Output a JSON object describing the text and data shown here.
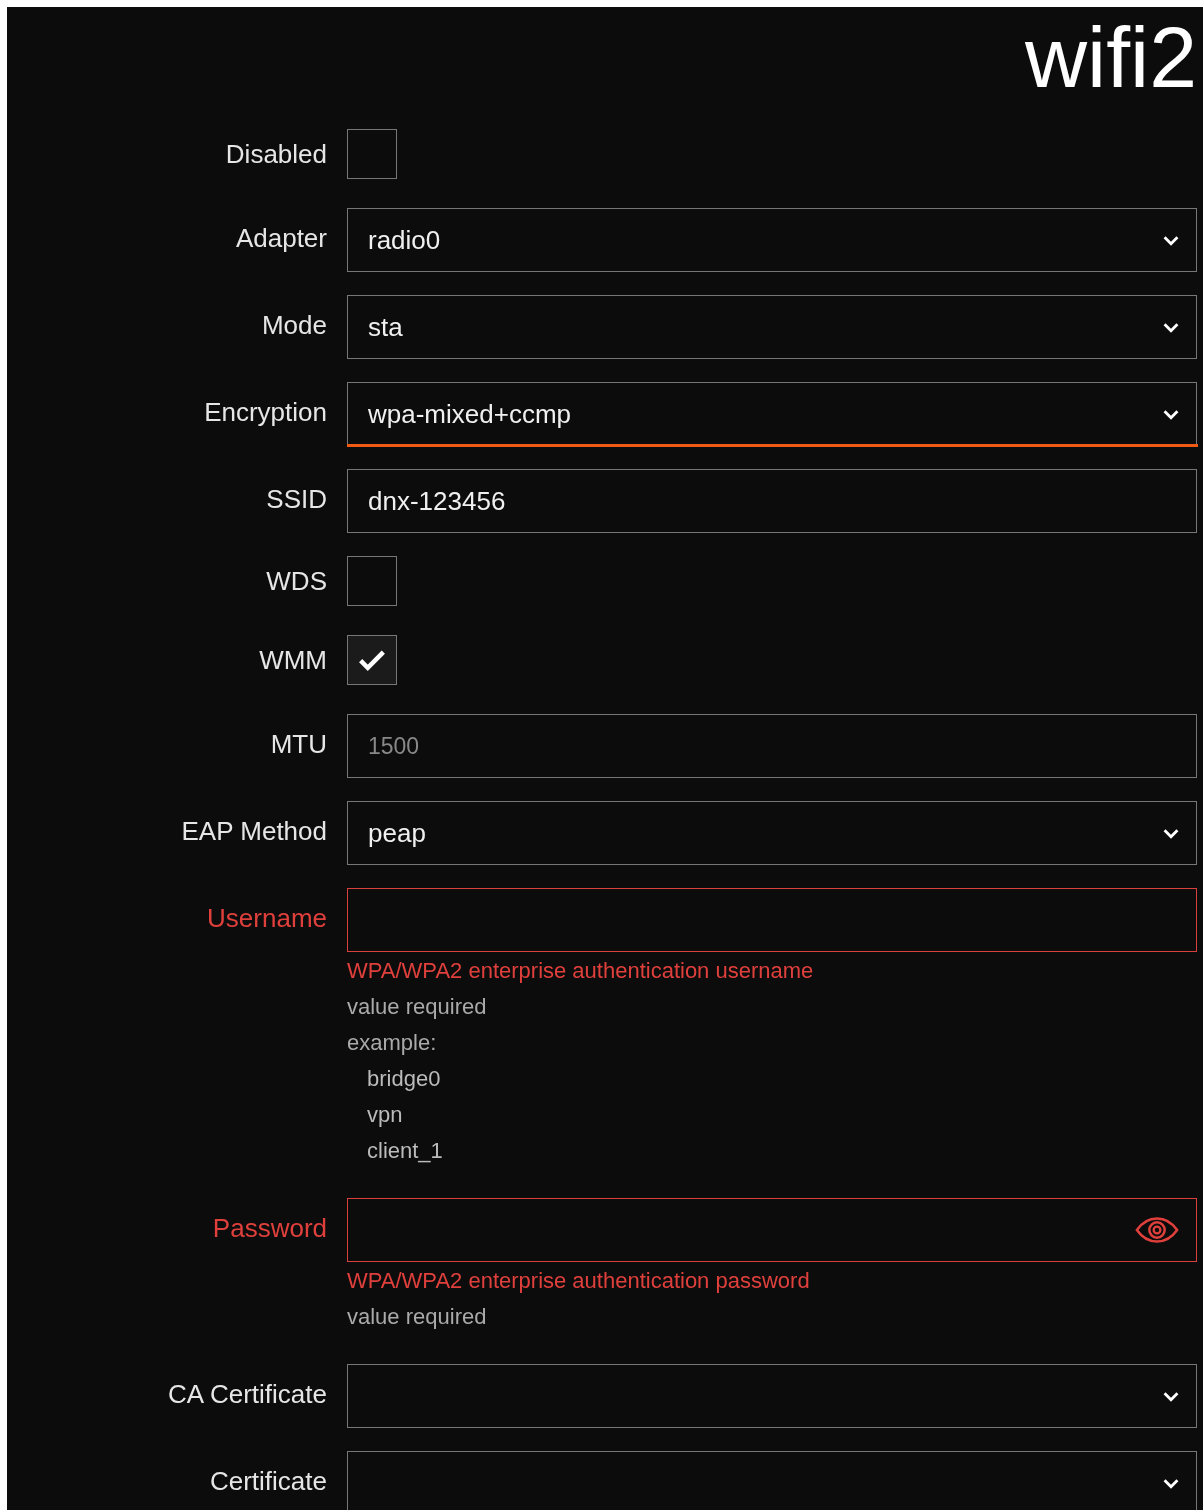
{
  "title": "wifi2",
  "fields": [
    {
      "kind": "checkbox",
      "label": "Disabled",
      "checked": false,
      "invalid": false
    },
    {
      "kind": "select",
      "label": "Adapter",
      "value": "radio0",
      "focused": false,
      "invalid": false
    },
    {
      "kind": "select",
      "label": "Mode",
      "value": "sta",
      "focused": false,
      "invalid": false
    },
    {
      "kind": "select",
      "label": "Encryption",
      "value": "wpa-mixed+ccmp",
      "focused": true,
      "invalid": false
    },
    {
      "kind": "text",
      "label": "SSID",
      "value": "dnx-123456",
      "focused": false,
      "invalid": false
    },
    {
      "kind": "checkbox",
      "label": "WDS",
      "checked": false,
      "invalid": false
    },
    {
      "kind": "checkbox",
      "label": "WMM",
      "checked": true,
      "invalid": false
    },
    {
      "kind": "text",
      "label": "MTU",
      "placeholder": "1500",
      "focused": false,
      "invalid": false
    },
    {
      "kind": "select",
      "label": "EAP Method",
      "value": "peap",
      "focused": false,
      "invalid": false
    },
    {
      "kind": "text",
      "label": "Username",
      "focused": false,
      "invalid": true,
      "hint": "WPA/WPA2 enterprise authentication username",
      "error": "value required",
      "example_label": "example:",
      "examples": [
        "bridge0",
        "vpn",
        "client_1"
      ]
    },
    {
      "kind": "password",
      "label": "Password",
      "focused": false,
      "invalid": true,
      "hint": "WPA/WPA2 enterprise authentication password",
      "error": "value required"
    },
    {
      "kind": "select",
      "label": "CA Certificate",
      "focused": false,
      "invalid": false
    },
    {
      "kind": "select",
      "label": "Certificate",
      "focused": false,
      "invalid": false
    }
  ]
}
